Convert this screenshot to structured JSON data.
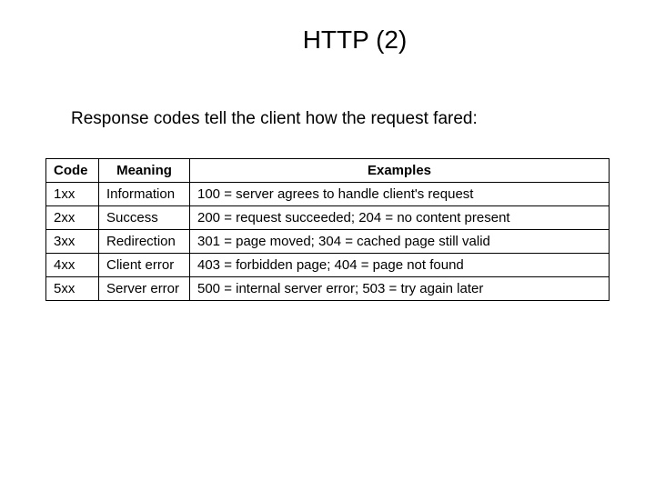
{
  "title": "HTTP (2)",
  "subtitle": "Response codes tell the client how the request fared:",
  "chart_data": {
    "type": "table",
    "headers": [
      "Code",
      "Meaning",
      "Examples"
    ],
    "rows": [
      {
        "code": "1xx",
        "meaning": "Information",
        "examples": "100 = server agrees to handle client's request"
      },
      {
        "code": "2xx",
        "meaning": "Success",
        "examples": "200 = request succeeded; 204 = no content present"
      },
      {
        "code": "3xx",
        "meaning": "Redirection",
        "examples": "301 = page moved; 304 = cached page still valid"
      },
      {
        "code": "4xx",
        "meaning": "Client error",
        "examples": "403 = forbidden page; 404 = page not found"
      },
      {
        "code": "5xx",
        "meaning": "Server error",
        "examples": "500 = internal server error; 503 = try again later"
      }
    ]
  }
}
